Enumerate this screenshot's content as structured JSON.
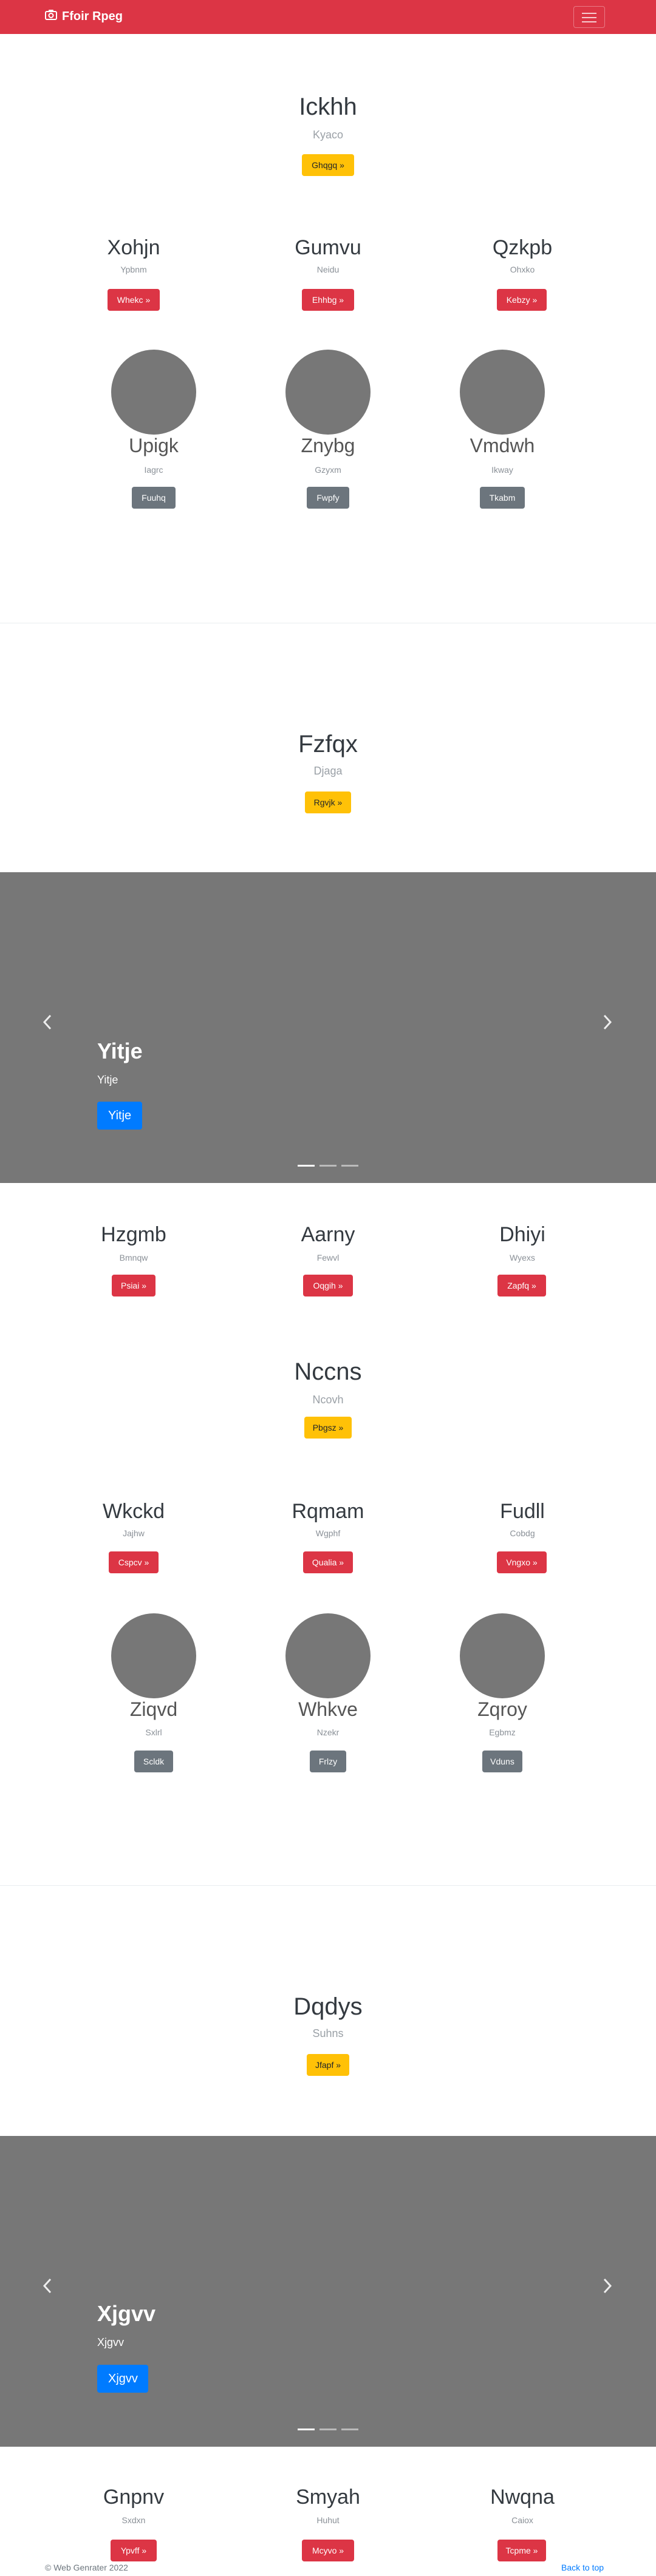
{
  "nav": {
    "brand": "Ffoir Rpeg"
  },
  "hero1": {
    "title": "Ickhh",
    "subtitle": "Kyaco",
    "button": "Ghqgq »"
  },
  "cols1": [
    {
      "title": "Xohjn",
      "sub": "Ypbnm",
      "button": "Whekc »"
    },
    {
      "title": "Gumvu",
      "sub": "Neidu",
      "button": "Ehhbg »"
    },
    {
      "title": "Qzkpb",
      "sub": "Ohxko",
      "button": "Kebzy »"
    }
  ],
  "circles1": [
    {
      "title": "Upigk",
      "sub": "Iagrc",
      "button": "Fuuhq"
    },
    {
      "title": "Znybg",
      "sub": "Gzyxm",
      "button": "Fwpfy"
    },
    {
      "title": "Vmdwh",
      "sub": "Ikway",
      "button": "Tkabm"
    }
  ],
  "hero2": {
    "title": "Fzfqx",
    "subtitle": "Djaga",
    "button": "Rgvjk »"
  },
  "carousel1": {
    "title": "Yitje",
    "subtitle": "Yitje",
    "button": "Yitje"
  },
  "cols2": [
    {
      "title": "Hzgmb",
      "sub": "Bmnqw",
      "button": "Psiai »"
    },
    {
      "title": "Aarny",
      "sub": "Fewvl",
      "button": "Oqgih »"
    },
    {
      "title": "Dhiyi",
      "sub": "Wyexs",
      "button": "Zapfq »"
    }
  ],
  "hero3": {
    "title": "Nccns",
    "subtitle": "Ncovh",
    "button": "Pbgsz »"
  },
  "cols3": [
    {
      "title": "Wkckd",
      "sub": "Jajhw",
      "button": "Cspcv »"
    },
    {
      "title": "Rqmam",
      "sub": "Wgphf",
      "button": "Qualia »"
    },
    {
      "title": "Fudll",
      "sub": "Cobdg",
      "button": "Vngxo »"
    }
  ],
  "circles2": [
    {
      "title": "Ziqvd",
      "sub": "Sxlrl",
      "button": "Scldk"
    },
    {
      "title": "Whkve",
      "sub": "Nzekr",
      "button": "Frlzy"
    },
    {
      "title": "Zqroy",
      "sub": "Egbmz",
      "button": "Vduns"
    }
  ],
  "hero4": {
    "title": "Dqdys",
    "subtitle": "Suhns",
    "button": "Jfapf »"
  },
  "carousel2": {
    "title": "Xjgvv",
    "subtitle": "Xjgvv",
    "button": "Xjgvv"
  },
  "cols4": [
    {
      "title": "Gnpnv",
      "sub": "Sxdxn",
      "button": "Ypvff »"
    },
    {
      "title": "Smyah",
      "sub": "Huhut",
      "button": "Mcyvo »"
    },
    {
      "title": "Nwqna",
      "sub": "Caiox",
      "button": "Tcpme »"
    }
  ],
  "footer": {
    "copyright": "© Web Genrater 2022",
    "back_to_top": "Back to top"
  },
  "icons": {
    "brand": "camera-icon",
    "menu": "hamburger-menu-icon",
    "prev": "chevron-left-icon",
    "next": "chevron-right-icon"
  },
  "colors": {
    "navbar": "#dc3545",
    "primary": "#007bff",
    "warning": "#ffc107",
    "secondary": "#6c757d",
    "carousel_bg": "#777777"
  }
}
